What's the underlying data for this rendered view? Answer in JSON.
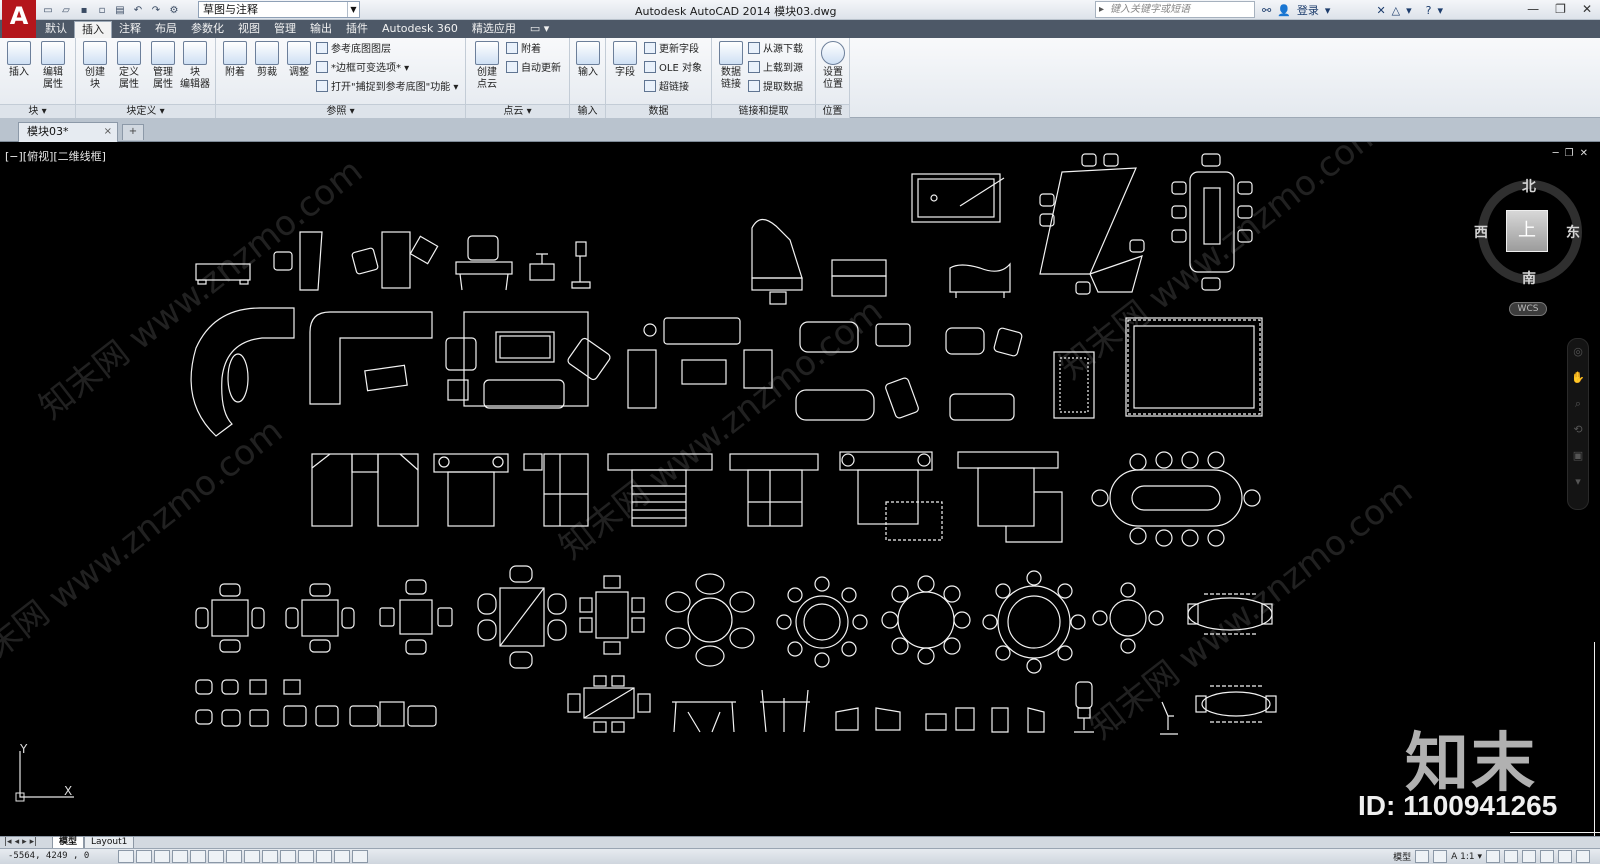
{
  "window": {
    "app_logo": "A",
    "title": "Autodesk AutoCAD 2014    模块03.dwg",
    "workspace": "草图与注释",
    "search_placeholder": "键入关键字或短语",
    "login": "登录",
    "controls": [
      "—",
      "❐",
      "✕"
    ]
  },
  "ribbon_tabs": [
    "默认",
    "插入",
    "注释",
    "布局",
    "参数化",
    "视图",
    "管理",
    "输出",
    "插件",
    "Autodesk 360",
    "精选应用",
    "▭ ▾"
  ],
  "active_tab": "插入",
  "ribbon": {
    "block": {
      "title": "块 ▾",
      "insert": "插入",
      "edit_attr": "编辑\n属性"
    },
    "block_def": {
      "title": "块定义 ▾",
      "create": "创建\n块",
      "define_attr": "定义\n属性",
      "manage_attr": "管理\n属性",
      "block_editor": "块\n编辑器"
    },
    "reference": {
      "title": "参照 ▾",
      "attach": "附着",
      "clip": "剪裁",
      "adjust": "调整",
      "underlay_layers": "参考底图图层",
      "frame_variable": "*边框可变选项* ▾",
      "snap_underlay": "打开\"捕捉到参考底图\"功能 ▾"
    },
    "pointcloud": {
      "title": "点云 ▾",
      "create": "创建\n点云",
      "attach": "附着",
      "auto_update": "自动更新"
    },
    "import": {
      "title": "输入",
      "import": "输入"
    },
    "data": {
      "title": "数据",
      "field": "字段",
      "update_fields": "更新字段",
      "ole": "OLE 对象",
      "hyperlink": "超链接"
    },
    "linking": {
      "title": "链接和提取",
      "data_link": "数据\n链接",
      "download_source": "从源下载",
      "upload_source": "上载到源",
      "extract_data": "提取数据"
    },
    "location": {
      "title": "位置",
      "set_location": "设置\n位置"
    }
  },
  "doc_tabs": {
    "active": "模块03*",
    "close": "×",
    "new": "+"
  },
  "canvas": {
    "view_label": "[−][俯视][二维线框]",
    "viewcube": {
      "north": "北",
      "south": "南",
      "east": "东",
      "west": "西",
      "top": "上",
      "wcs": "WCS"
    },
    "watermark": "知末网 www.znzmo.com",
    "brand": "知末",
    "brand_id": "ID: 1100941265",
    "ucs_x": "X",
    "ucs_y": "Y"
  },
  "layout_tabs": [
    "模型",
    "Layout1"
  ],
  "status": {
    "coords": "-5564,  4249 ,  0",
    "scale": "A 1:1 ▾",
    "model": "模型"
  }
}
